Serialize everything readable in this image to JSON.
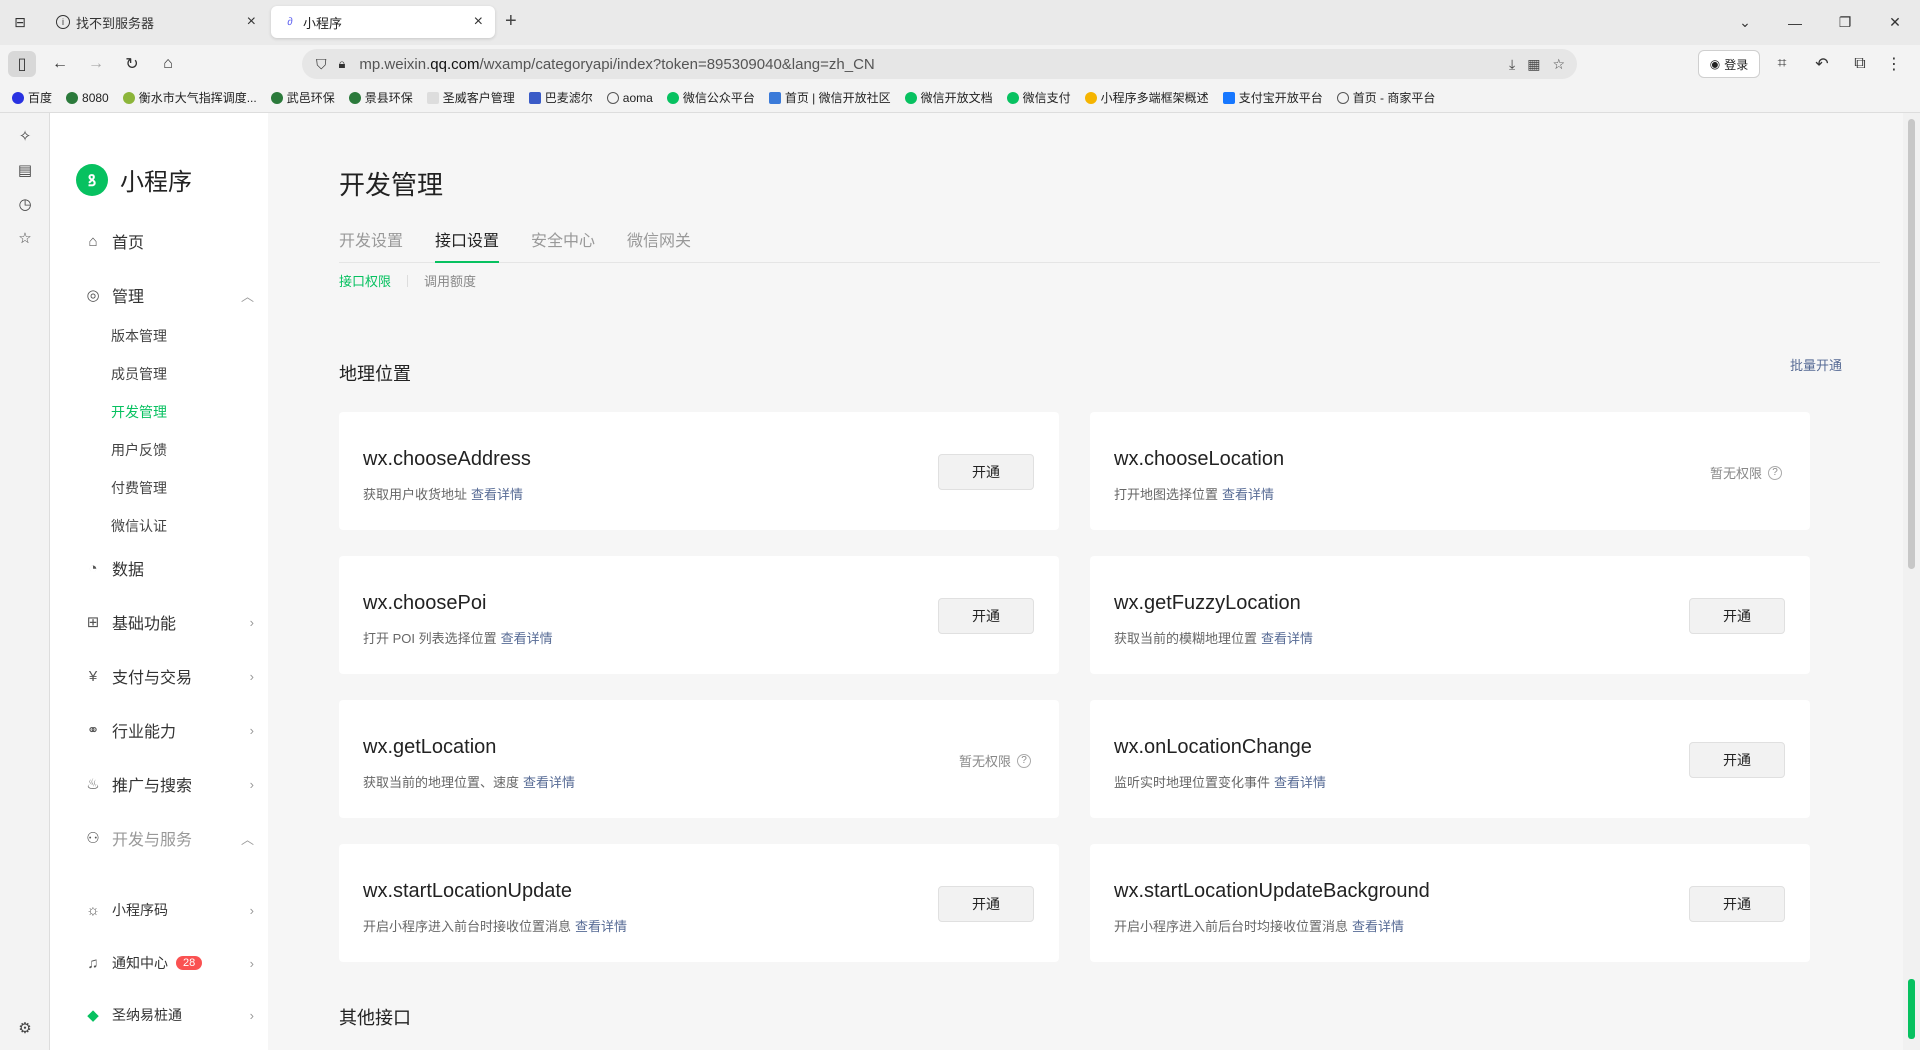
{
  "browser": {
    "tabs": [
      {
        "label": "找不到服务器",
        "active": false
      },
      {
        "label": "小程序",
        "active": true
      }
    ],
    "url_prefix": "mp.weixin.",
    "url_domain": "qq.com",
    "url_rest": "/wxamp/categoryapi/index?token=895309040&lang=zh_CN",
    "login_label": "登录",
    "bookmarks": [
      "百度",
      "8080",
      "衡水市大气指挥调度...",
      "武邑环保",
      "景县环保",
      "圣威客户管理",
      "巴麦滤尔",
      "aoma",
      "微信公众平台",
      "首页 | 微信开放社区",
      "微信开放文档",
      "微信支付",
      "小程序多端框架概述",
      "支付宝开放平台",
      "首页 - 商家平台"
    ]
  },
  "sidebar": {
    "app_name": "小程序",
    "home": "首页",
    "manage": "管理",
    "manage_items": [
      "版本管理",
      "成员管理",
      "开发管理",
      "用户反馈",
      "付费管理",
      "微信认证"
    ],
    "data": "数据",
    "basic": "基础功能",
    "pay": "支付与交易",
    "industry": "行业能力",
    "promo": "推广与搜索",
    "devservice": "开发与服务",
    "qrcode": "小程序码",
    "notify": "通知中心",
    "notify_count": "28",
    "tenant": "圣纳易桩通"
  },
  "main": {
    "title": "开发管理",
    "tabs": [
      "开发设置",
      "接口设置",
      "安全中心",
      "微信网关"
    ],
    "subtabs": [
      "接口权限",
      "调用额度"
    ],
    "section_geo": "地理位置",
    "batch_open": "批量开通",
    "section_other": "其他接口",
    "detail_link": "查看详情",
    "open_label": "开通",
    "no_perm_label": "暂无权限",
    "apis": [
      {
        "name": "wx.chooseAddress",
        "desc": "获取用户收货地址",
        "status": "open"
      },
      {
        "name": "wx.chooseLocation",
        "desc": "打开地图选择位置",
        "status": "none"
      },
      {
        "name": "wx.choosePoi",
        "desc": "打开 POI 列表选择位置",
        "status": "open"
      },
      {
        "name": "wx.getFuzzyLocation",
        "desc": "获取当前的模糊地理位置",
        "status": "open"
      },
      {
        "name": "wx.getLocation",
        "desc": "获取当前的地理位置、速度",
        "status": "none"
      },
      {
        "name": "wx.onLocationChange",
        "desc": "监听实时地理位置变化事件",
        "status": "open"
      },
      {
        "name": "wx.startLocationUpdate",
        "desc": "开启小程序进入前台时接收位置消息",
        "status": "open"
      },
      {
        "name": "wx.startLocationUpdateBackground",
        "desc": "开启小程序进入前后台时均接收位置消息",
        "status": "open"
      }
    ]
  }
}
